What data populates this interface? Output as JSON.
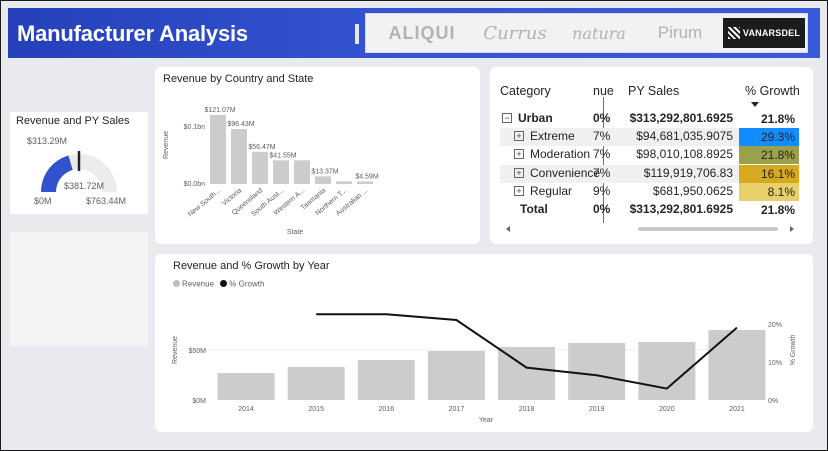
{
  "header": {
    "title": "Manufacturer Analysis",
    "logos": [
      "ALIQUI",
      "Currus",
      "natura",
      "Pirum",
      "VANARSDEL"
    ]
  },
  "gauge": {
    "title": "Revenue and PY Sales",
    "value_label": "$313.29M",
    "target_label": "$381.72M",
    "min_label": "$0M",
    "max_label": "$763.44M",
    "value": 313.29,
    "target": 381.72,
    "min": 0,
    "max": 763.44,
    "fill_color": "#3052cc",
    "track_color": "#ececec"
  },
  "country_chart": {
    "title": "Revenue by Country and State",
    "chart_data": {
      "type": "bar",
      "title": "Revenue by Country and State",
      "xlabel": "State",
      "ylabel": "Revenue",
      "categories": [
        "New South...",
        "Victoria",
        "Queensland",
        "South Aust...",
        "Western A...",
        "Tasmania",
        "Northern T...",
        "Australian ..."
      ],
      "values": [
        121.07,
        96.43,
        56.47,
        41.55,
        41.55,
        13.37,
        4.59,
        4.59
      ],
      "data_labels": [
        "$121.07M",
        "$96.43M",
        "$56.47M",
        "$41.55M",
        "",
        "$13.37M",
        "",
        "$4.59M"
      ],
      "ytick_labels": [
        "$0.0bn",
        "$0.1bn"
      ],
      "ylim": [
        0,
        135
      ],
      "color": "#cccccc"
    }
  },
  "matrix": {
    "headers": {
      "category": "Category",
      "rev": "nue",
      "py": "PY Sales",
      "growth": "% Growth"
    },
    "rows": [
      {
        "label": "Urban",
        "rev": "0%",
        "py": "$313,292,801.6925",
        "growth": "21.8%",
        "level": 0,
        "toggle": "−",
        "bold": true,
        "color": ""
      },
      {
        "label": "Extreme",
        "rev": "7%",
        "py": "$94,681,035.9075",
        "growth": "29.3%",
        "level": 1,
        "toggle": "+",
        "bold": false,
        "color": "#118dff"
      },
      {
        "label": "Moderation",
        "rev": "7%",
        "py": "$98,010,108.8925",
        "growth": "21.8%",
        "level": 1,
        "toggle": "+",
        "bold": false,
        "color": "#9aa04b"
      },
      {
        "label": "Convenience",
        "rev": "7%",
        "py": "$119,919,706.83",
        "growth": "16.1%",
        "level": 1,
        "toggle": "+",
        "bold": false,
        "color": "#d6aa1e"
      },
      {
        "label": "Regular",
        "rev": "9%",
        "py": "$681,950.0625",
        "growth": "8.1%",
        "level": 1,
        "toggle": "+",
        "bold": false,
        "color": "#e9cf69"
      },
      {
        "label": "Total",
        "rev": "0%",
        "py": "$313,292,801.6925",
        "growth": "21.8%",
        "level": 0,
        "toggle": "",
        "bold": true,
        "color": ""
      }
    ],
    "sort_icon": "sort-descending-icon"
  },
  "year_chart": {
    "title": "Revenue and % Growth by Year",
    "legend": [
      "Revenue",
      "% Growth"
    ],
    "chart_data": {
      "type": "bar",
      "title": "Revenue and % Growth by Year",
      "xlabel": "Year",
      "ylabel": "Revenue",
      "y2label": "% Growth",
      "categories": [
        "2014",
        "2015",
        "2016",
        "2017",
        "2018",
        "2019",
        "2020",
        "2021"
      ],
      "series": [
        {
          "name": "Revenue",
          "type": "bar",
          "values": [
            27,
            33,
            40,
            49,
            53,
            57,
            58,
            70
          ],
          "color": "#cccccc"
        },
        {
          "name": "% Growth",
          "type": "line",
          "values": [
            null,
            22.5,
            22.5,
            21,
            8.5,
            6.5,
            3,
            19
          ],
          "color": "#111111"
        }
      ],
      "ytick_labels": [
        "$0M",
        "$50M"
      ],
      "y2tick_labels": [
        "0%",
        "10%",
        "20%"
      ],
      "ylim": [
        0,
        100
      ],
      "y2lim": [
        0,
        21
      ]
    }
  }
}
